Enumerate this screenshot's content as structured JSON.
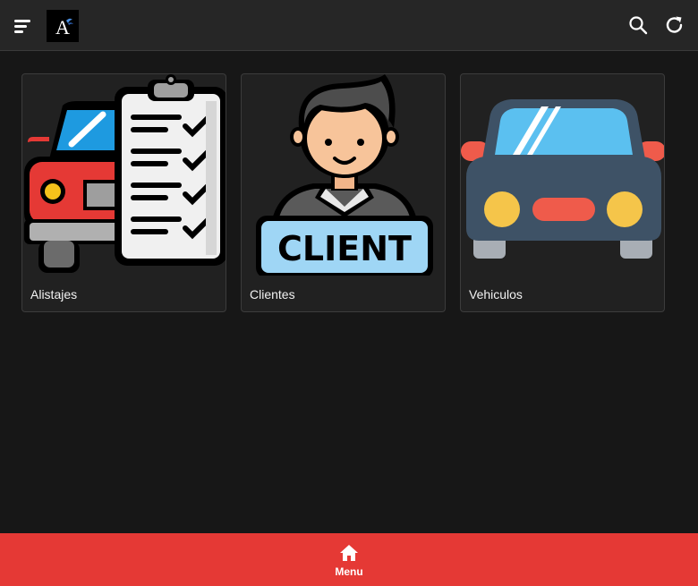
{
  "header": {
    "logo_text": "A",
    "icons": [
      "menu-icon",
      "search-icon",
      "refresh-icon"
    ]
  },
  "modules": [
    {
      "label": "Alistajes",
      "icon": "car-checklist-icon"
    },
    {
      "label": "Clientes",
      "icon": "client-icon",
      "sign_text": "CLIENT"
    },
    {
      "label": "Vehiculos",
      "icon": "car-front-icon"
    }
  ],
  "bottom_nav": {
    "label": "Menu",
    "icon": "home-icon"
  },
  "colors": {
    "topbar": "#262626",
    "background": "#171717",
    "card": "#212121",
    "accent": "#e53935"
  }
}
